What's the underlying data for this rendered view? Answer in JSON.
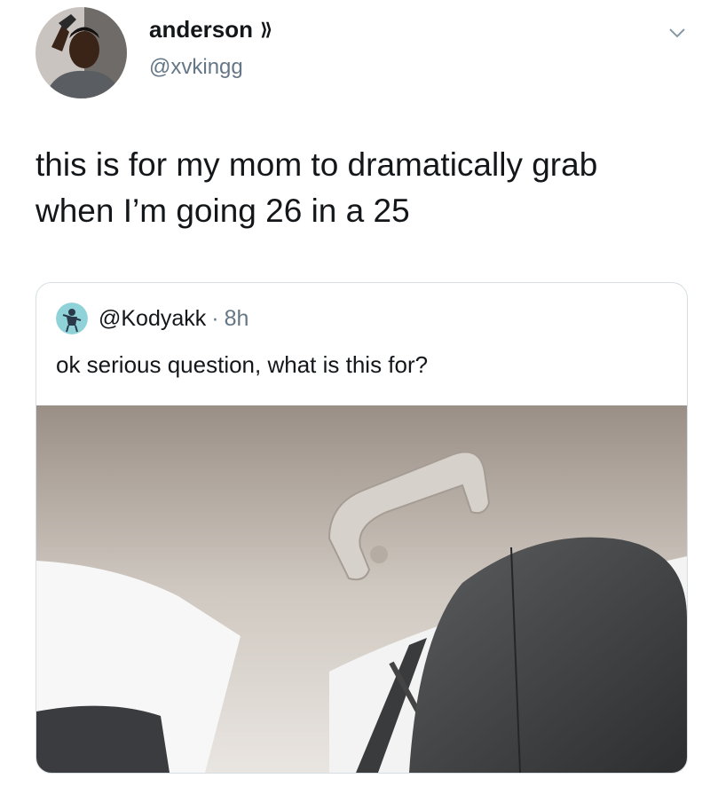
{
  "author": {
    "name": "anderson",
    "handle": "@xvkingg",
    "name_chevron": "⟫"
  },
  "tweet": {
    "line1": "this is for my mom to dramatically grab",
    "line2": "when I’m going 26 in a 25"
  },
  "quote": {
    "handle": "@Kodyakk",
    "separator": "·",
    "time": "8h",
    "text": "ok serious question, what is this for?"
  },
  "icons": {
    "menu": "chevron-down-icon",
    "verified": "double-chevron-icon"
  },
  "colors": {
    "text": "#14171a",
    "secondary": "#657786",
    "border": "#d6dee3"
  }
}
